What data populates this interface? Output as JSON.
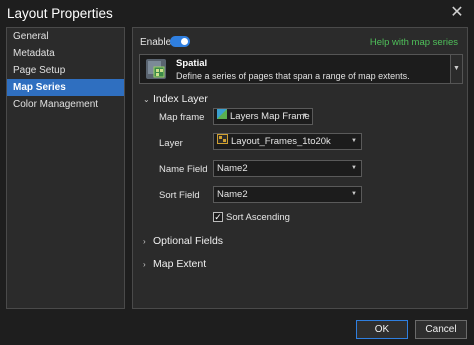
{
  "window": {
    "title": "Layout Properties",
    "close_glyph": "✕"
  },
  "nav": {
    "items": [
      {
        "label": "General"
      },
      {
        "label": "Metadata"
      },
      {
        "label": "Page Setup"
      },
      {
        "label": "Map Series",
        "active": true
      },
      {
        "label": "Color Management"
      }
    ]
  },
  "main": {
    "enable_label": "Enable",
    "enable_on": true,
    "help_link": "Help with map series",
    "series_type": {
      "name": "Spatial",
      "description": "Define a series of pages that span a range of map extents.",
      "icon": "spatial-map-series-icon"
    },
    "index_layer": {
      "header": "Index Layer",
      "map_frame_label": "Map frame",
      "map_frame_value": "Layers Map Frame",
      "layer_label": "Layer",
      "layer_value": "Layout_Frames_1to20k",
      "name_field_label": "Name Field",
      "name_field_value": "Name2",
      "sort_field_label": "Sort Field",
      "sort_field_value": "Name2",
      "sort_ascending_label": "Sort Ascending",
      "sort_ascending_checked": true
    },
    "optional_fields_header": "Optional Fields",
    "map_extent_header": "Map Extent"
  },
  "footer": {
    "ok_label": "OK",
    "cancel_label": "Cancel"
  },
  "colors": {
    "accent": "#2f7fe0",
    "nav_active": "#2f6fc0",
    "help_link": "#4fc05a",
    "background": "#1e1e1e",
    "panel": "#2b2b2b"
  }
}
